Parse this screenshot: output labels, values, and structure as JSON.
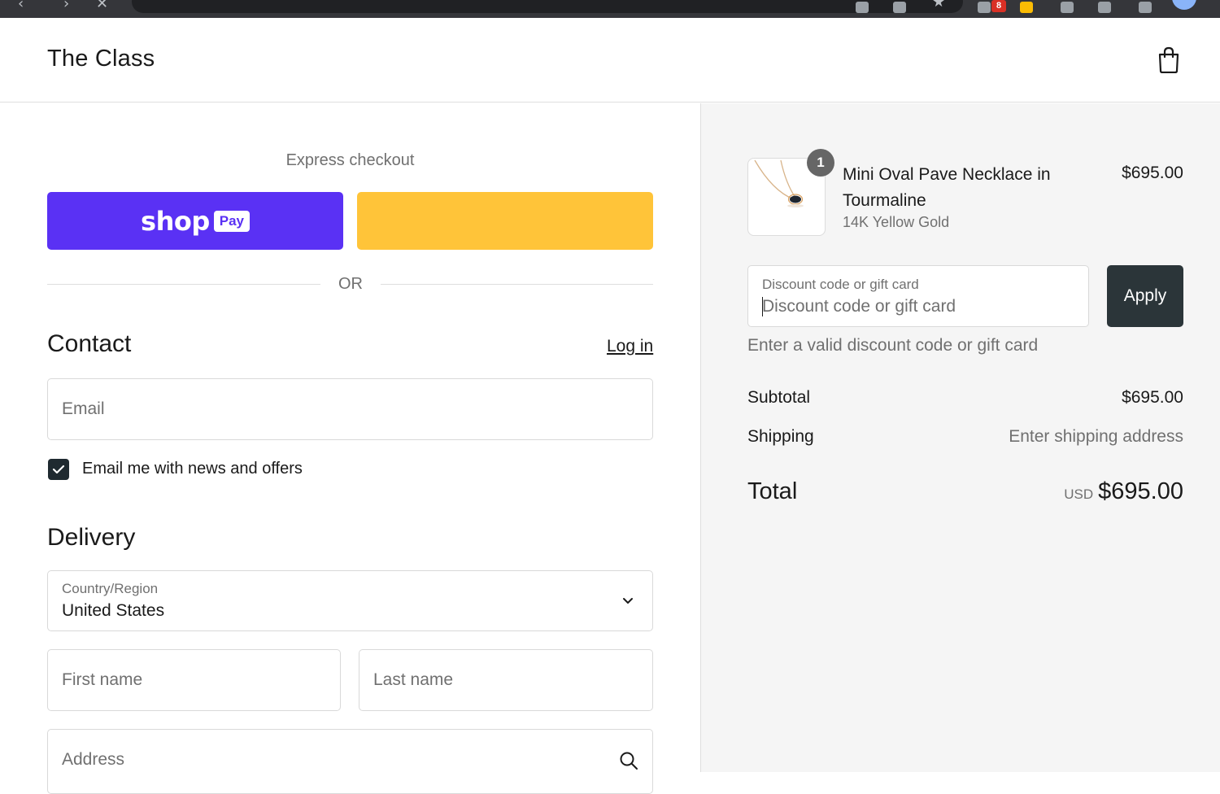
{
  "shop": {
    "name": "The Class"
  },
  "express": {
    "label": "Express checkout",
    "shoppay_word": "shop",
    "shoppay_pill": "Pay",
    "divider": "OR"
  },
  "contact": {
    "title": "Contact",
    "login_label": "Log in",
    "email_placeholder": "Email",
    "newsletter_label": "Email me with news and offers",
    "newsletter_checked": true
  },
  "delivery": {
    "title": "Delivery",
    "country_label": "Country/Region",
    "country_value": "United States",
    "first_name_placeholder": "First name",
    "last_name_placeholder": "Last name",
    "address_placeholder": "Address"
  },
  "summary": {
    "product": {
      "quantity": "1",
      "name": "Mini Oval Pave Necklace in Tourmaline",
      "variant": "14K Yellow Gold",
      "price": "$695.00"
    },
    "discount": {
      "label": "Discount code or gift card",
      "placeholder": "Discount code or gift card",
      "apply_label": "Apply",
      "error": "Enter a valid discount code or gift card"
    },
    "subtotal_label": "Subtotal",
    "subtotal_value": "$695.00",
    "shipping_label": "Shipping",
    "shipping_value": "Enter shipping address",
    "total_label": "Total",
    "currency": "USD",
    "total_value": "$695.00"
  },
  "browser": {
    "extension_badge": "8"
  },
  "colors": {
    "shoppay": "#5a31f4",
    "paypal": "#ffc439",
    "apply": "#2b3539",
    "checkbox": "#1f2a30"
  }
}
